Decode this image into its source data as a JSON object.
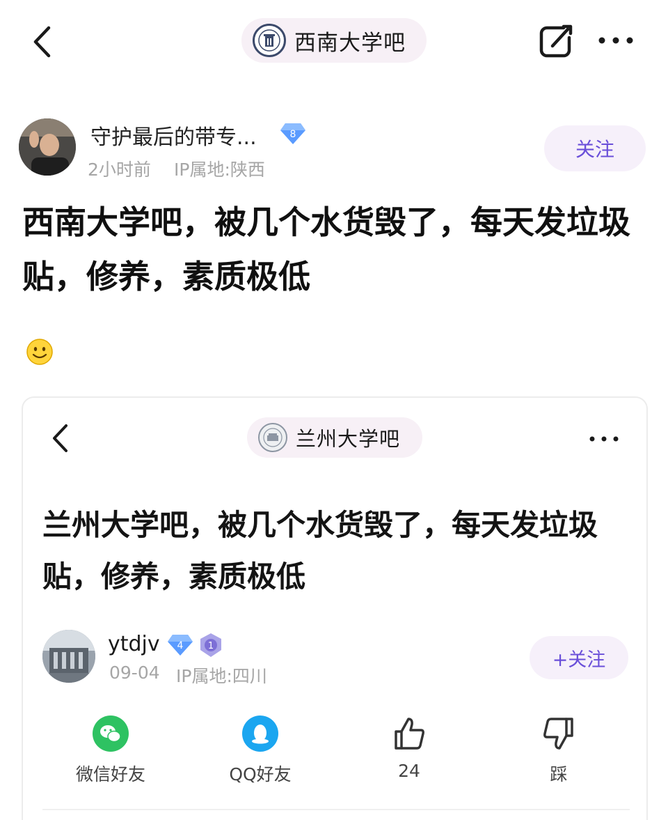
{
  "header": {
    "forum_name": "西南大学吧"
  },
  "post": {
    "author": {
      "name": "守护最后的带专...",
      "level": "8",
      "time": "2小时前",
      "ip_location": "IP属地:陕西"
    },
    "follow_label": "关注",
    "title": "西南大学吧，被几个水货毁了，每天发垃圾贴，修养，素质极低",
    "emoji": "smiley-face"
  },
  "embedded": {
    "forum_name": "兰州大学吧",
    "title": "兰州大学吧，被几个水货毁了，每天发垃圾贴，修养，素质极低",
    "author": {
      "name": "ytdjv",
      "level": "4",
      "badge": "1",
      "date": "09-04",
      "ip_location": "IP属地:四川"
    },
    "follow_label": "+关注",
    "actions": [
      {
        "icon": "wechat-icon",
        "label": "微信好友"
      },
      {
        "icon": "qq-icon",
        "label": "QQ好友"
      },
      {
        "icon": "thumbs-up-icon",
        "label": "24"
      },
      {
        "icon": "thumbs-down-icon",
        "label": "踩"
      }
    ]
  },
  "colors": {
    "accent": "#6a4fd9",
    "pill_bg": "#f7f0f6",
    "meta_gray": "#a6a6a6",
    "wechat_green": "#2ec262",
    "qq_blue": "#1ba6f0",
    "level_badge_blue": "#5a9bff"
  }
}
